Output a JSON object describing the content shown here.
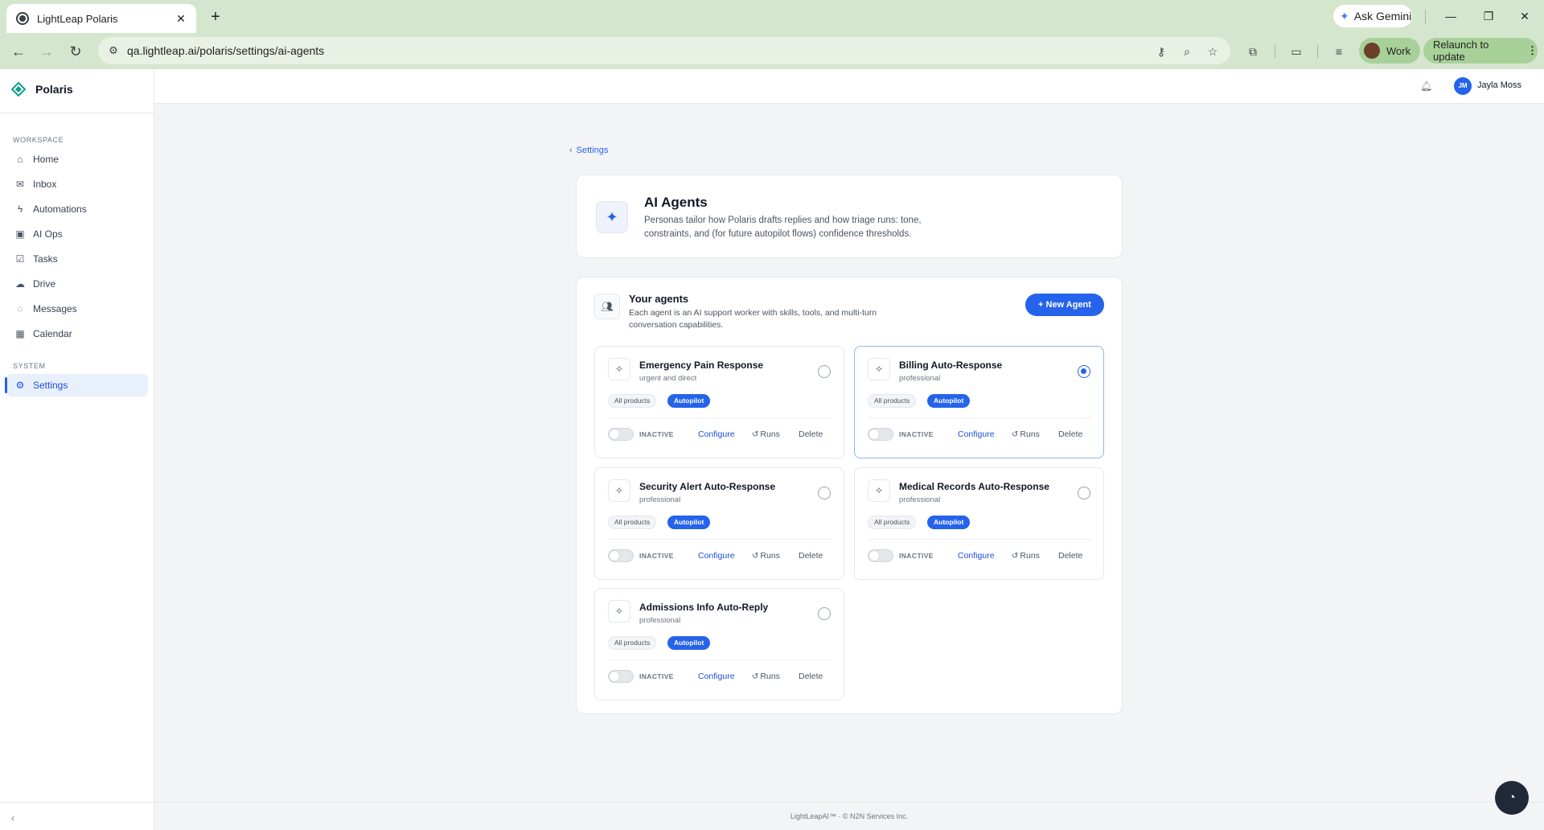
{
  "browser": {
    "tab_title": "LightLeap Polaris",
    "tab_close": "✕",
    "new_tab": "+",
    "gemini_label": "Ask Gemini",
    "url": "qa.lightleap.ai/polaris/settings/ai-agents",
    "profile_label": "Work",
    "relaunch_label": "Relaunch to update"
  },
  "sidebar": {
    "brand": "Polaris",
    "workspace_label": "WORKSPACE",
    "system_label": "SYSTEM",
    "items": [
      {
        "label": "Home",
        "icon": "home-icon"
      },
      {
        "label": "Inbox",
        "icon": "inbox-icon"
      },
      {
        "label": "Automations",
        "icon": "bolt-icon"
      },
      {
        "label": "AI Ops",
        "icon": "chip-icon"
      },
      {
        "label": "Tasks",
        "icon": "checkbox-icon"
      },
      {
        "label": "Drive",
        "icon": "cloud-icon"
      },
      {
        "label": "Messages",
        "icon": "chat-icon"
      },
      {
        "label": "Calendar",
        "icon": "calendar-icon"
      }
    ],
    "system_items": [
      {
        "label": "Settings",
        "icon": "gear-icon",
        "active": true
      }
    ]
  },
  "topbar": {
    "avatar_initials": "JM",
    "user_name": "Jayla Moss"
  },
  "page": {
    "breadcrumb": "Settings",
    "title": "AI Agents",
    "description": "Personas tailor how Polaris drafts replies and how triage runs: tone, constraints, and (for future autopilot flows) confidence thresholds."
  },
  "agents_section": {
    "title": "Your agents",
    "description": "Each agent is an AI support worker with skills, tools, and multi-turn conversation capabilities.",
    "new_agent_label": "New Agent",
    "agents": [
      {
        "name": "Emergency Pain Response",
        "tone": "urgent and direct",
        "products": "All products",
        "mode": "Autopilot",
        "status": "INACTIVE",
        "selected": false
      },
      {
        "name": "Billing Auto-Response",
        "tone": "professional",
        "products": "All products",
        "mode": "Autopilot",
        "status": "INACTIVE",
        "selected": true
      },
      {
        "name": "Security Alert Auto-Response",
        "tone": "professional",
        "products": "All products",
        "mode": "Autopilot",
        "status": "INACTIVE",
        "selected": false
      },
      {
        "name": "Medical Records Auto-Response",
        "tone": "professional",
        "products": "All products",
        "mode": "Autopilot",
        "status": "INACTIVE",
        "selected": false
      },
      {
        "name": "Admissions Info Auto-Reply",
        "tone": "professional",
        "products": "All products",
        "mode": "Autopilot",
        "status": "INACTIVE",
        "selected": false
      }
    ],
    "actions": {
      "configure": "Configure",
      "runs": "Runs",
      "delete": "Delete"
    }
  },
  "footer": {
    "text": "LightLeapAI™ · © N2N Services Inc."
  },
  "colors": {
    "accent": "#2563eb",
    "chrome": "#d5e6cf"
  }
}
